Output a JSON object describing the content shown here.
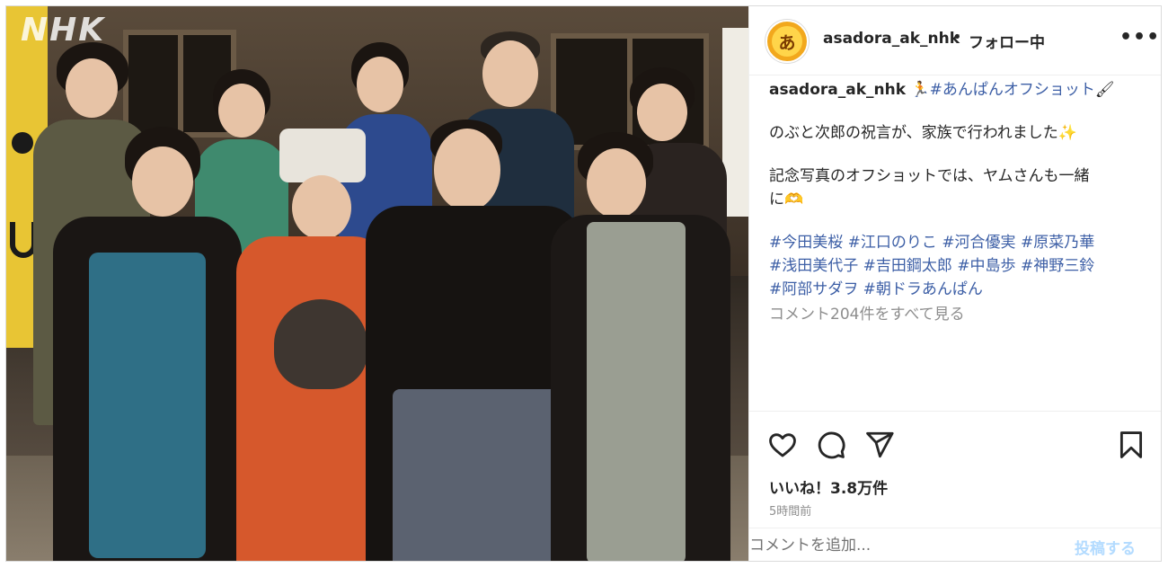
{
  "photo": {
    "watermark": "NHK",
    "alt_subject": "photo-of-cast"
  },
  "header": {
    "username": "asadora_ak_nhk",
    "separator": "•",
    "follow_status": "フォロー中",
    "more": "•••",
    "avatar_glyph": "あ"
  },
  "caption": {
    "username": "asadora_ak_nhk",
    "lead_emoji": "🏃",
    "hashtag_title": "#あんぱんオフショット",
    "title_emoji": "🖌",
    "line1": "のぶと次郎の祝言が、家族で行われました",
    "line1_emoji": "✨",
    "line2a": "記念写真のオフショットでは、ヤムさんも一緒",
    "line2b": "に",
    "line2_emoji": "🫶",
    "hashtags_line1": [
      "#今田美桜",
      "#江口のりこ",
      "#河合優実",
      "#原菜乃華"
    ],
    "hashtags_line2": [
      "#浅田美代子",
      "#吉田鋼太郎",
      "#中島歩",
      "#神野三鈴"
    ],
    "hashtags_line3": [
      "#阿部サダヲ",
      "#朝ドラあんぱん"
    ],
    "view_comments": "コメント204件をすべて見る"
  },
  "actions": {
    "like_icon": "heart-icon",
    "comment_icon": "comment-icon",
    "share_icon": "share-icon",
    "save_icon": "bookmark-icon"
  },
  "likes": "いいね！3.8万件",
  "timestamp": "5時間前",
  "comment_box": {
    "placeholder": "コメントを追加...",
    "post_label": "投稿する"
  },
  "colors": {
    "hashtag": "#3d5fa6",
    "post_button_disabled": "#b3dbff",
    "muted": "#8e8e8e",
    "text": "#262626"
  }
}
